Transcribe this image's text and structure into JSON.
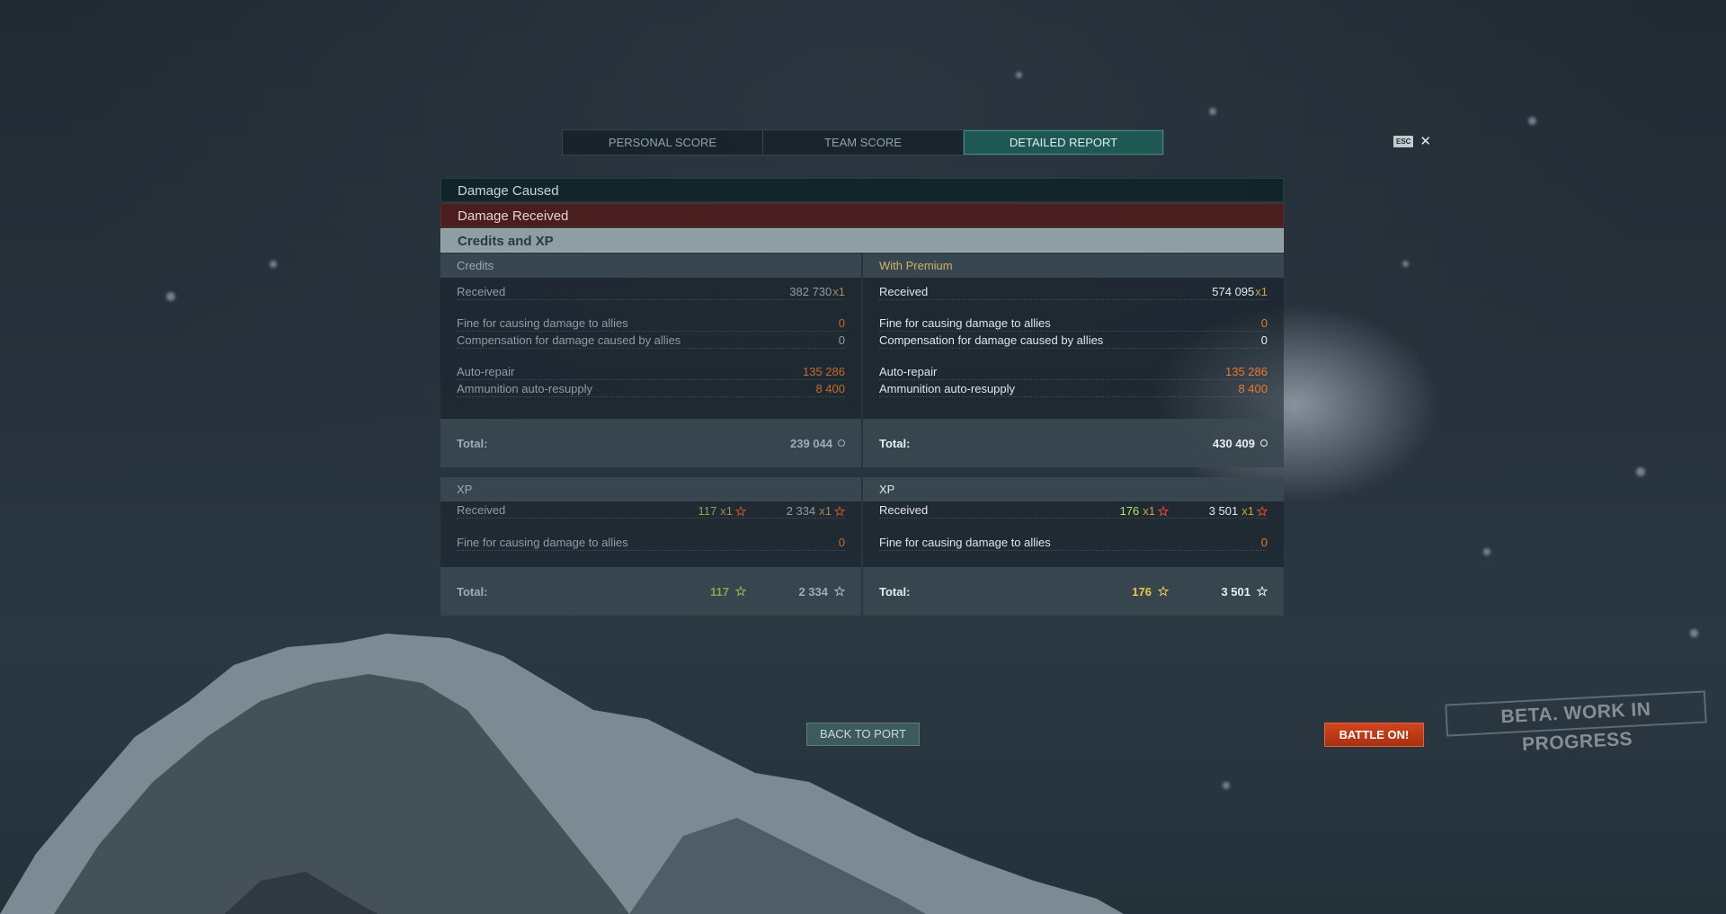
{
  "tabs": [
    "PERSONAL SCORE",
    "TEAM SCORE",
    "DETAILED REPORT"
  ],
  "active_tab": "DETAILED REPORT",
  "close": {
    "key_label": "ESC",
    "symbol": "✕"
  },
  "sections": {
    "damage_caused": "Damage Caused",
    "damage_received": "Damage Received",
    "credits_xp": "Credits and XP"
  },
  "credits": {
    "left": {
      "title": "Credits",
      "received_label": "Received",
      "received_value": "382 730",
      "received_mult": "x1",
      "fine_label": "Fine for causing damage to allies",
      "fine_value": "0",
      "comp_label": "Compensation for damage caused by allies",
      "comp_value": "0",
      "repair_label": "Auto-repair",
      "repair_value": "135 286",
      "ammo_label": "Ammunition auto-resupply",
      "ammo_value": "8 400",
      "total_label": "Total:",
      "total_value": "239 044"
    },
    "right": {
      "title": "With Premium",
      "received_label": "Received",
      "received_value": "574 095",
      "received_mult": "x1",
      "fine_label": "Fine for causing damage to allies",
      "fine_value": "0",
      "comp_label": "Compensation for damage caused by allies",
      "comp_value": "0",
      "repair_label": "Auto-repair",
      "repair_value": "135 286",
      "ammo_label": "Ammunition auto-resupply",
      "ammo_value": "8 400",
      "total_label": "Total:",
      "total_value": "430 409"
    }
  },
  "xp": {
    "left": {
      "title": "XP",
      "received_label": "Received",
      "received_a": "117",
      "received_a_mult": "x1",
      "received_b": "2 334",
      "received_b_mult": "x1",
      "fine_label": "Fine for causing damage to allies",
      "fine_value": "0",
      "total_label": "Total:",
      "total_a": "117",
      "total_b": "2 334"
    },
    "right": {
      "title": "XP",
      "received_label": "Received",
      "received_a": "176",
      "received_a_mult": "x1",
      "received_b": "3 501",
      "received_b_mult": "x1",
      "fine_label": "Fine for causing damage to allies",
      "fine_value": "0",
      "total_label": "Total:",
      "total_a": "176",
      "total_b": "3 501"
    }
  },
  "buttons": {
    "back_to_port": "BACK TO PORT",
    "battle_on": "BATTLE ON!"
  },
  "watermark": "BETA. WORK IN PROGRESS",
  "icons": {
    "credits": "coin-icon",
    "xp": "star-icon",
    "elite_xp": "gear-star-icon"
  },
  "colors": {
    "accent_teal": "#1f5853",
    "fine_orange": "#e8792e",
    "premium_gold": "#ccb265",
    "battle_red": "#c43c17"
  }
}
